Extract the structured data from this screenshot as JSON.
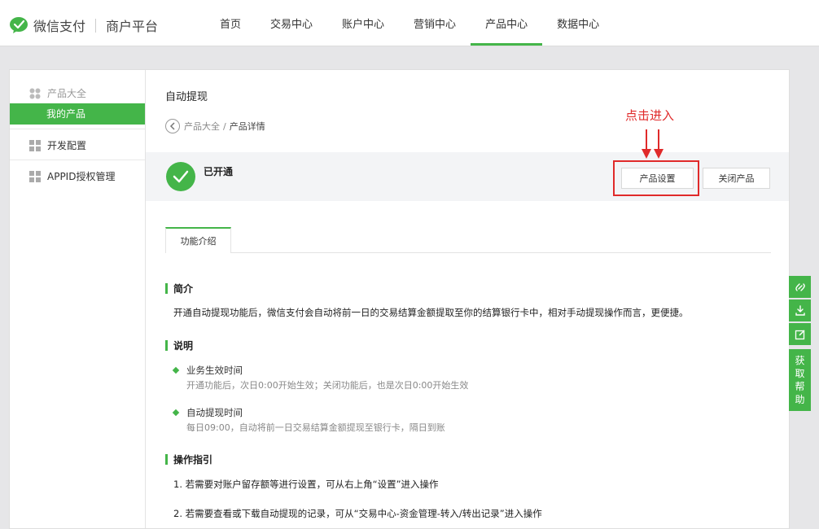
{
  "brand": {
    "name": "微信支付",
    "platform": "商户平台"
  },
  "nav": [
    {
      "label": "首页"
    },
    {
      "label": "交易中心"
    },
    {
      "label": "账户中心"
    },
    {
      "label": "营销中心"
    },
    {
      "label": "产品中心",
      "active": true
    },
    {
      "label": "数据中心"
    }
  ],
  "sidebar": {
    "product_all": "产品大全",
    "my_products": "我的产品",
    "dev_config": "开发配置",
    "appid_auth": "APPID授权管理"
  },
  "page": {
    "title": "自动提现",
    "breadcrumb_parent": "产品大全",
    "breadcrumb_separator": "/",
    "breadcrumb_current": "产品详情"
  },
  "status": {
    "label": "已开通",
    "settings_button": "产品设置",
    "close_button": "关闭产品"
  },
  "annotation": {
    "text": "点击进入",
    "color": "#e02a2a"
  },
  "tab": {
    "label": "功能介绍"
  },
  "sections": {
    "intro": {
      "heading": "简介",
      "text": "开通自动提现功能后，微信支付会自动将前一日的交易结算金额提取至你的结算银行卡中，相对手动提现操作而言，更便捷。"
    },
    "notes": {
      "heading": "说明",
      "items": [
        {
          "title": "业务生效时间",
          "desc": "开通功能后，次日0:00开始生效；关闭功能后，也是次日0:00开始生效"
        },
        {
          "title": "自动提现时间",
          "desc": "每日09:00，自动将前一日交易结算金额提现至银行卡，隔日到账"
        }
      ]
    },
    "guide": {
      "heading": "操作指引",
      "steps": [
        "1. 若需要对账户留存额等进行设置，可从右上角“设置”进入操作",
        "2. 若需要查看或下载自动提现的记录，可从“交易中心-资金管理-转入/转出记录”进入操作"
      ]
    }
  },
  "help": {
    "label": "获取帮助"
  },
  "colors": {
    "accent": "#44b549",
    "annotation": "#e02a2a"
  }
}
